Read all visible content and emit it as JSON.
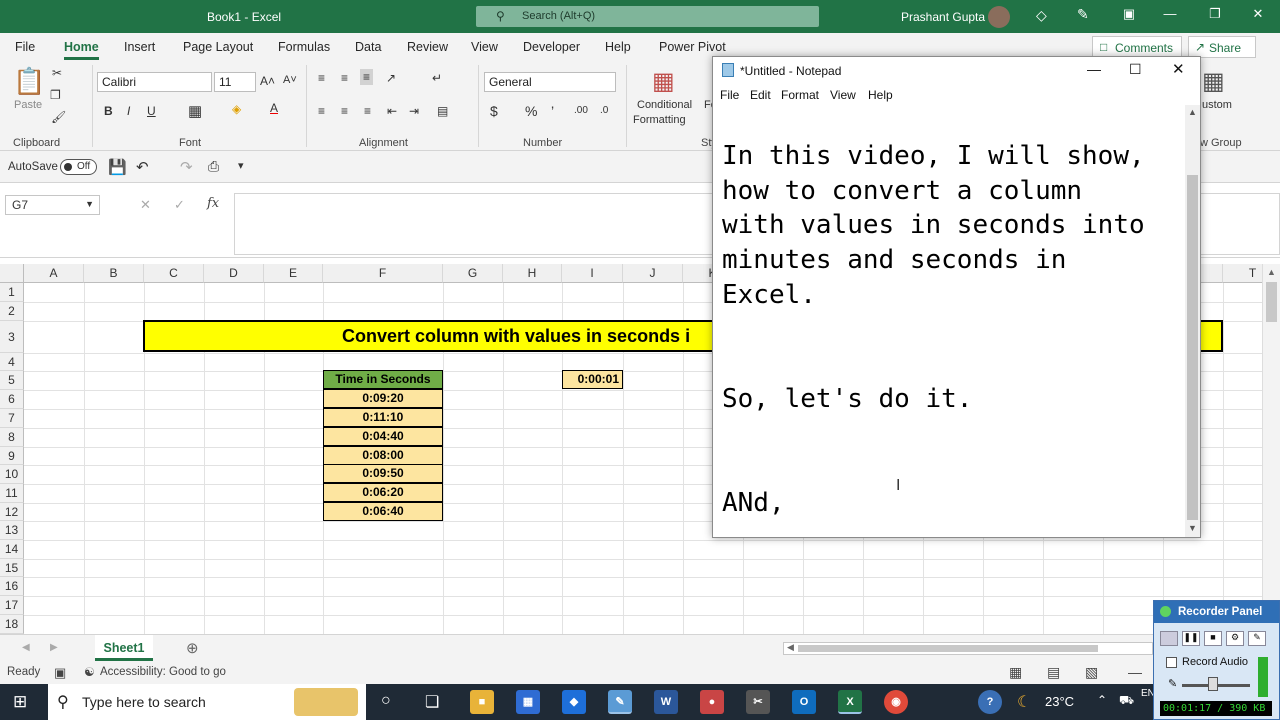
{
  "excel": {
    "title": "Book1  -  Excel",
    "search_placeholder": "Search (Alt+Q)",
    "user": "Prashant Gupta",
    "menu": [
      "File",
      "Home",
      "Insert",
      "Page Layout",
      "Formulas",
      "Data",
      "Review",
      "View",
      "Developer",
      "Help",
      "Power Pivot"
    ],
    "comments_label": "Comments",
    "share_label": "Share",
    "ribbon": {
      "paste_label": "Paste",
      "clipboard_label": "Clipboard",
      "font_name": "Calibri",
      "font_size": "11",
      "font_label": "Font",
      "alignment_label": "Alignment",
      "number_format": "General",
      "number_label": "Number",
      "conditional_label": "Conditional",
      "formatting_label": "Formatting",
      "styles_partial": "Sty",
      "custom_partial": "ustom",
      "view_group_partial": "w Group",
      "fo_partial": "Fo"
    },
    "autosave_label": "AutoSave",
    "autosave_state": "Off",
    "name_box": "G7",
    "fx_label": "fx",
    "columns": [
      "A",
      "B",
      "C",
      "D",
      "E",
      "F",
      "G",
      "H",
      "I",
      "J",
      "K"
    ],
    "last_col": "T",
    "rows": [
      "1",
      "2",
      "3",
      "4",
      "5",
      "6",
      "7",
      "8",
      "9",
      "10",
      "11",
      "12",
      "13",
      "14",
      "15",
      "16",
      "17",
      "18"
    ],
    "banner_text": "Convert column with values in seconds i",
    "table_header": "Time in Seconds",
    "table_values": [
      "0:09:20",
      "0:11:10",
      "0:04:40",
      "0:08:00",
      "0:09:50",
      "0:06:20",
      "0:06:40"
    ],
    "cell_i5": "0:00:01",
    "sheet_tab": "Sheet1",
    "status_ready": "Ready",
    "status_accessibility": "Accessibility: Good to go"
  },
  "notepad": {
    "title": "*Untitled - Notepad",
    "menu": [
      "File",
      "Edit",
      "Format",
      "View",
      "Help"
    ],
    "lines": [
      "In this video, I will show,",
      "how to convert a column",
      "with values in seconds into",
      "minutes and seconds in",
      "Excel.",
      "",
      "",
      "So, let's do it.",
      "",
      "",
      "ANd,"
    ]
  },
  "taskbar": {
    "search_placeholder": "Type here to search",
    "temperature": "23°C",
    "lang": "EN"
  },
  "recorder": {
    "title": "Recorder Panel",
    "record_audio_label": "Record Audio",
    "timer": "00:01:17 / 390 KB"
  },
  "colors": {
    "excel_green": "#217346",
    "banner_yellow": "#ffff00",
    "table_header_green": "#70ad47",
    "table_cell_gold": "#fde5a0",
    "taskbar": "#1f2a36"
  }
}
